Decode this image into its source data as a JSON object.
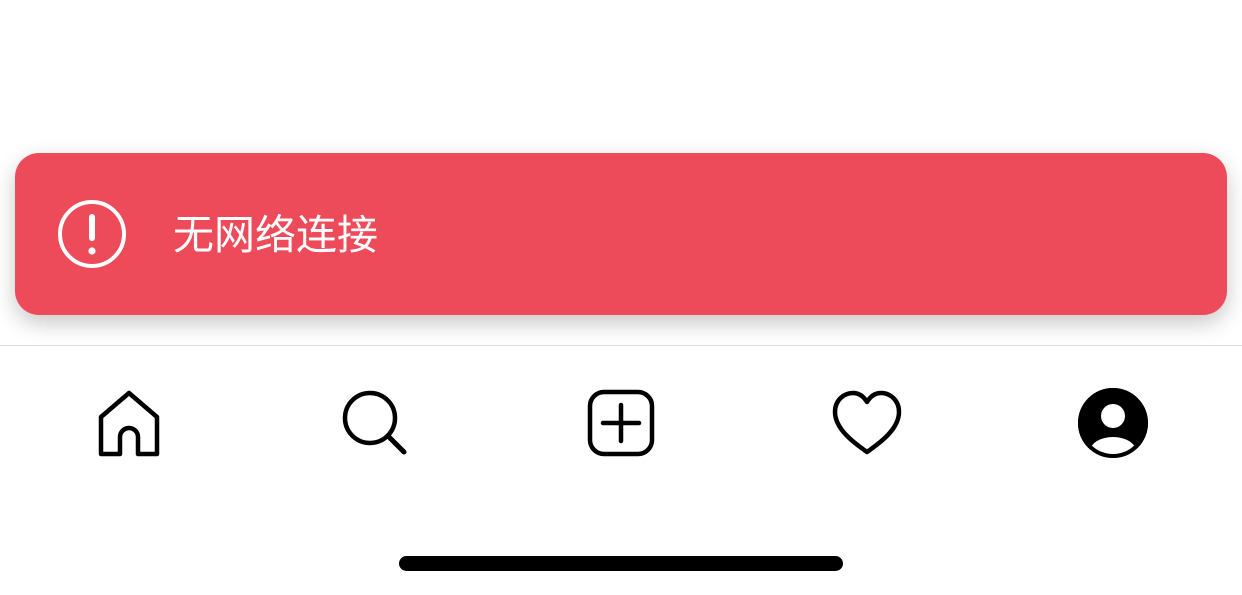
{
  "toast": {
    "message": "无网络连接",
    "icon": "alert-circle-icon",
    "background_color": "#ee4b5a",
    "text_color": "#ffffff"
  },
  "tab_bar": {
    "items": [
      {
        "id": "home",
        "icon": "home-icon"
      },
      {
        "id": "search",
        "icon": "search-icon"
      },
      {
        "id": "create",
        "icon": "plus-square-icon"
      },
      {
        "id": "activity",
        "icon": "heart-icon"
      },
      {
        "id": "profile",
        "icon": "profile-avatar-icon"
      }
    ]
  }
}
